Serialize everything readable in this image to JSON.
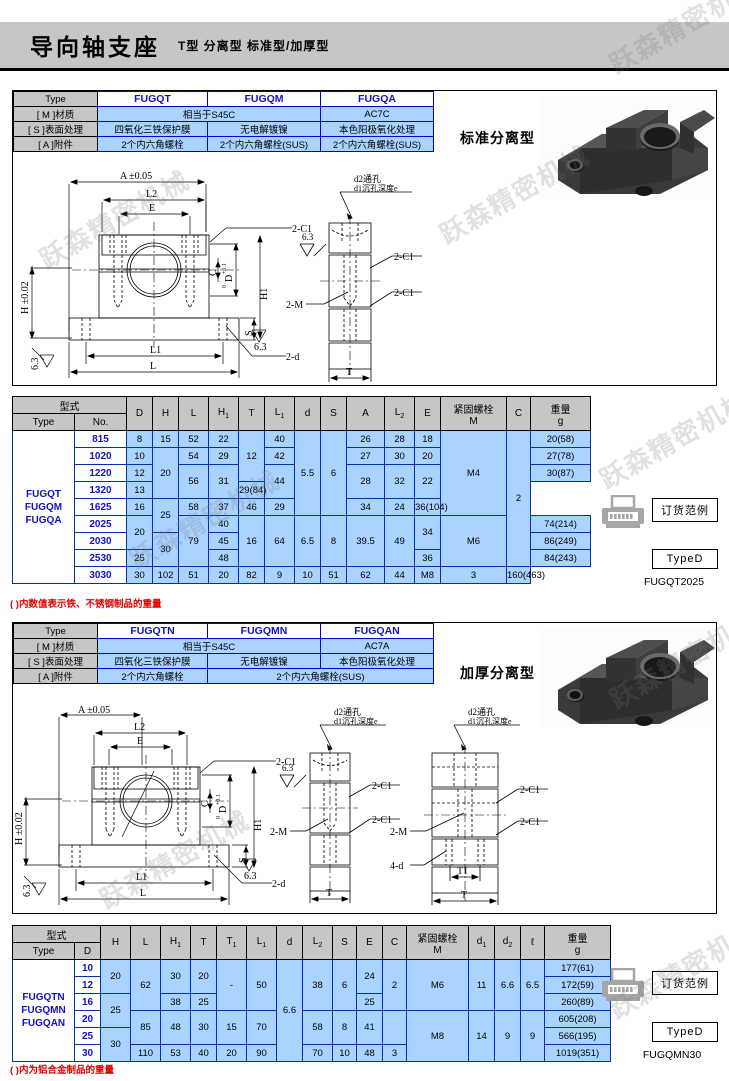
{
  "header": {
    "title": "导向轴支座",
    "subtitle": "T型  分离型  标准型/加厚型"
  },
  "watermarks": [
    "跃森精密机械",
    "跃森精密机械",
    "跃森精密机械",
    "跃森精密机械",
    "跃森精密机械",
    "跃森精密机械",
    "跃森精密机械",
    "跃森精密机械"
  ],
  "section1": {
    "photo_label": "标准分离型",
    "material_table": {
      "row_headers": [
        "Type",
        "[ M ]材质",
        "[ S ]表面处理",
        "[ A ]附件"
      ],
      "codes": [
        "FUGQT",
        "FUGQM",
        "FUGQA"
      ],
      "material": [
        "相当于S45C",
        "AC7C"
      ],
      "surface": [
        "四氧化三铁保护膜",
        "无电解镀镍",
        "本色阳极氧化处理"
      ],
      "accessory": [
        "2个内六角螺栓",
        "2个内六角螺栓(SUS)",
        "2个内六角螺栓(SUS)"
      ]
    },
    "drawing_labels": {
      "a_tol": "A ±0.05",
      "l2": "L2",
      "e": "E",
      "c": "C",
      "d_tol": "D",
      "d_tol_sup": "+0.1",
      "d_tol_sub": "0",
      "h1": "H1",
      "h_tol": "H ±0.02",
      "s": "S",
      "l1": "L1",
      "l": "L",
      "t": "T",
      "chamfer": "2-C1",
      "two_m": "2-M",
      "two_d": "2-d",
      "rough": "6.3",
      "hole_d2": "d2通孔",
      "hole_d1": "d1沉孔深度e"
    },
    "spec_table": {
      "group_header": "型式",
      "headers": [
        "Type",
        "No.",
        "D",
        "H",
        "L",
        "H1",
        "T",
        "L1",
        "d",
        "S",
        "A",
        "L2",
        "E",
        "紧固螺栓\nM",
        "C",
        "重量\ng"
      ],
      "type_label": "FUGQT\nFUGQM\nFUGQA",
      "rows": [
        {
          "no": "815",
          "D": "8",
          "H": "15",
          "L": "52",
          "H1": "22",
          "T": "",
          "L1": "40",
          "d": "",
          "S": "",
          "A": "26",
          "L2": "28",
          "E": "18",
          "M": "",
          "C": "",
          "W": "20(58)"
        },
        {
          "no": "1020",
          "D": "10",
          "H": "",
          "L": "54",
          "H1": "29",
          "T": "",
          "L1": "42",
          "d": "",
          "S": "",
          "A": "27",
          "L2": "30",
          "E": "20",
          "M": "",
          "C": "",
          "W": "27(78)"
        },
        {
          "no": "1220",
          "D": "12",
          "H": "20",
          "L": "56",
          "H1": "31",
          "T": "12",
          "L1": "44",
          "d": "5.5",
          "S": "6",
          "A": "28",
          "L2": "32",
          "E": "22",
          "M": "M4",
          "C": "",
          "W": "30(87)"
        },
        {
          "no": "1320",
          "D": "13",
          "H": "",
          "L": "",
          "H1": "",
          "T": "",
          "L1": "",
          "d": "",
          "S": "",
          "A": "",
          "L2": "",
          "E": "",
          "M": "",
          "C": "2",
          "W": "29(84)"
        },
        {
          "no": "1625",
          "D": "16",
          "H": "25",
          "L": "58",
          "H1": "37",
          "T": "",
          "L1": "46",
          "d": "",
          "S": "",
          "A": "29",
          "L2": "34",
          "E": "24",
          "M": "",
          "C": "",
          "W": "36(104)"
        },
        {
          "no": "2025",
          "D": "20",
          "H": "",
          "L": "79",
          "H1": "40",
          "T": "16",
          "L1": "64",
          "d": "6.5",
          "S": "8",
          "A": "39.5",
          "L2": "49",
          "E": "34",
          "M": "M6",
          "C": "",
          "W": "74(214)"
        },
        {
          "no": "2030",
          "D": "",
          "H": "30",
          "L": "",
          "H1": "45",
          "T": "",
          "L1": "",
          "d": "",
          "S": "",
          "A": "",
          "L2": "",
          "E": "",
          "M": "",
          "C": "",
          "W": "86(249)"
        },
        {
          "no": "2530",
          "D": "25",
          "H": "",
          "L": "",
          "H1": "48",
          "T": "",
          "L1": "",
          "d": "",
          "S": "",
          "A": "",
          "L2": "",
          "E": "36",
          "M": "",
          "C": "",
          "W": "84(243)"
        },
        {
          "no": "3030",
          "D": "30",
          "H": "",
          "L": "102",
          "H1": "51",
          "T": "20",
          "L1": "82",
          "d": "9",
          "S": "10",
          "A": "51",
          "L2": "62",
          "E": "44",
          "M": "M8",
          "C": "3",
          "W": "160(463)"
        }
      ]
    },
    "footnote": "( )内数值表示铁、不锈钢制品的重量",
    "order": {
      "title": "订货范例",
      "type": "TypeD",
      "code": "FUGQT2025"
    }
  },
  "section2": {
    "photo_label": "加厚分离型",
    "material_table": {
      "row_headers": [
        "Type",
        "[ M ]材质",
        "[ S ]表面处理",
        "[ A ]附件"
      ],
      "codes": [
        "FUGQTN",
        "FUGQMN",
        "FUGQAN"
      ],
      "material": [
        "相当于S45C",
        "AC7A"
      ],
      "surface": [
        "四氧化三铁保护膜",
        "无电解镀镍",
        "本色阳极氧化处理"
      ],
      "accessory": [
        "2个内六角螺栓",
        "2个内六角螺栓(SUS)"
      ]
    },
    "drawing_labels": {
      "a_tol": "A ±0.05",
      "l2": "L2",
      "e": "E",
      "c": "C",
      "d_tol": "D",
      "d_tol_sup": "+0.1",
      "d_tol_sub": "0",
      "h1": "H1",
      "h_tol": "H ±0.02",
      "s": "S",
      "l1": "L1",
      "l": "L",
      "t": "T",
      "t1": "T1",
      "chamfer": "2-C1",
      "two_m": "2-M",
      "two_d": "2-d",
      "four_d": "4-d",
      "rough": "6.3",
      "hole_d2": "d2通孔",
      "hole_d1": "d1沉孔深度e"
    },
    "spec_table": {
      "group_header": "型式",
      "headers": [
        "Type",
        "D",
        "H",
        "L",
        "H1",
        "T",
        "T1",
        "L1",
        "d",
        "L2",
        "S",
        "E",
        "C",
        "紧固螺栓\nM",
        "d1",
        "d2",
        "ℓ",
        "重量\ng"
      ],
      "type_label": "FUGQTN\nFUGQMN\nFUGQAN",
      "rows": [
        {
          "D": "10",
          "H": "20",
          "L": "62",
          "H1": "30",
          "T": "20",
          "T1": "-",
          "L1": "50",
          "d": "",
          "L2": "38",
          "S": "6",
          "E": "24",
          "C": "",
          "M": "M6",
          "d1": "11",
          "d2": "6.6",
          "l": "6.5",
          "W": "177(61)"
        },
        {
          "D": "12",
          "H": "",
          "L": "",
          "H1": "",
          "T": "",
          "T1": "",
          "L1": "",
          "d": "",
          "L2": "",
          "S": "",
          "E": "",
          "C": "",
          "M": "",
          "d1": "",
          "d2": "",
          "l": "",
          "W": "172(59)"
        },
        {
          "D": "16",
          "H": "25",
          "L": "",
          "H1": "38",
          "T": "25",
          "T1": "",
          "L1": "",
          "d": "6.6",
          "L2": "",
          "S": "",
          "E": "25",
          "C": "2",
          "M": "",
          "d1": "",
          "d2": "",
          "l": "",
          "W": "260(89)"
        },
        {
          "D": "20",
          "H": "",
          "L": "85",
          "H1": "48",
          "T": "30",
          "T1": "15",
          "L1": "70",
          "d": "",
          "L2": "58",
          "S": "8",
          "E": "41",
          "C": "",
          "M": "M8",
          "d1": "14",
          "d2": "9",
          "l": "9",
          "W": "605(208)"
        },
        {
          "D": "25",
          "H": "30",
          "L": "",
          "H1": "",
          "T": "",
          "T1": "",
          "L1": "",
          "d": "",
          "L2": "",
          "S": "",
          "E": "",
          "C": "",
          "M": "",
          "d1": "",
          "d2": "",
          "l": "",
          "W": "566(195)"
        },
        {
          "D": "30",
          "H": "",
          "L": "110",
          "H1": "53",
          "T": "40",
          "T1": "20",
          "L1": "90",
          "d": "",
          "L2": "70",
          "S": "10",
          "E": "48",
          "C": "3",
          "M": "",
          "d1": "",
          "d2": "",
          "l": "",
          "W": "1019(351)"
        }
      ]
    },
    "footnote": "( )内为铝合金制品的重量",
    "order": {
      "title": "订货范例",
      "type": "TypeD",
      "code": "FUGQMN30"
    }
  }
}
